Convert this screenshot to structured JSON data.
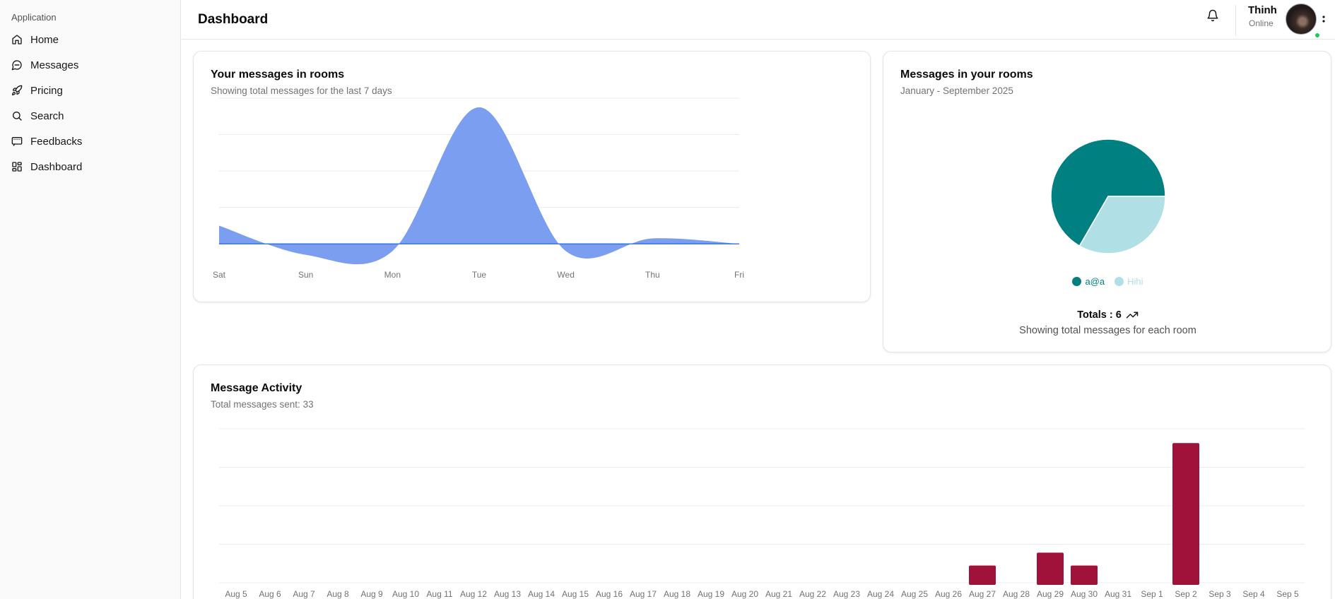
{
  "sidebar": {
    "group_label": "Application",
    "items": [
      {
        "label": "Home",
        "icon": "home-icon"
      },
      {
        "label": "Messages",
        "icon": "message-circle-icon"
      },
      {
        "label": "Pricing",
        "icon": "rocket-icon"
      },
      {
        "label": "Search",
        "icon": "search-icon"
      },
      {
        "label": "Feedbacks",
        "icon": "feedback-icon"
      },
      {
        "label": "Dashboard",
        "icon": "dashboard-icon"
      }
    ]
  },
  "header": {
    "title": "Dashboard",
    "user_name": "Thinh",
    "user_status": "Online",
    "icons": [
      "bell-icon",
      "more-vertical-icon"
    ]
  },
  "cards": {
    "area": {
      "title": "Your messages in rooms",
      "description": "Showing total messages for the last 7 days"
    },
    "pie": {
      "title": "Messages in your rooms",
      "description": "January - September 2025",
      "totals": "Totals : 6",
      "footer": "Showing total messages for each room"
    },
    "bar": {
      "title": "Message Activity",
      "description": "Total messages sent: 33"
    }
  },
  "colors": {
    "area_fill": "#7c9ef0",
    "area_line": "#2563eb",
    "pie_a": "#008080",
    "pie_b": "#b0e0e6",
    "bar": "#a0123a",
    "online": "#22c55e"
  },
  "chart_data": [
    {
      "type": "area",
      "categories": [
        "Sat",
        "Sun",
        "Mon",
        "Tue",
        "Wed",
        "Thu",
        "Fri"
      ],
      "values": [
        1.0,
        -0.6,
        -0.4,
        7.5,
        -0.4,
        0.3,
        0
      ],
      "ylim": [
        -1,
        8
      ],
      "grid": true
    },
    {
      "type": "pie",
      "categories": [
        "a@a",
        "Hihi"
      ],
      "values": [
        4,
        2
      ],
      "legend": "bottom"
    },
    {
      "type": "bar",
      "categories": [
        "Aug 5",
        "Aug 6",
        "Aug 7",
        "Aug 8",
        "Aug 9",
        "Aug 10",
        "Aug 11",
        "Aug 12",
        "Aug 13",
        "Aug 14",
        "Aug 15",
        "Aug 16",
        "Aug 17",
        "Aug 18",
        "Aug 19",
        "Aug 20",
        "Aug 21",
        "Aug 22",
        "Aug 23",
        "Aug 24",
        "Aug 25",
        "Aug 26",
        "Aug 27",
        "Aug 28",
        "Aug 29",
        "Aug 30",
        "Aug 31",
        "Sep 1",
        "Sep 2",
        "Sep 3",
        "Sep 4",
        "Sep 5"
      ],
      "values": [
        0,
        0,
        0,
        0,
        0,
        0,
        0,
        0,
        0,
        0,
        0,
        0,
        0,
        0,
        0,
        0,
        0,
        0,
        0,
        0,
        0,
        0,
        3,
        0,
        5,
        3,
        0,
        0,
        22,
        0,
        0,
        0
      ],
      "ylim": [
        0,
        24
      ],
      "grid": true
    }
  ]
}
